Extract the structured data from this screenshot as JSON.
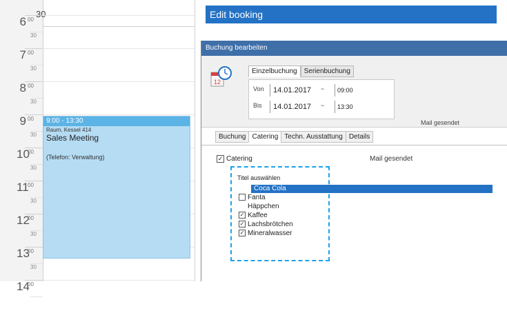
{
  "calendar": {
    "top_number": "30",
    "hours": [
      {
        "h": "6",
        "m": "00",
        "half": "30"
      },
      {
        "h": "7",
        "m": "00",
        "half": "30"
      },
      {
        "h": "8",
        "m": "00",
        "half": "30"
      },
      {
        "h": "9",
        "m": "00",
        "half": "30"
      },
      {
        "h": "10",
        "m": "00",
        "half": "30"
      },
      {
        "h": "11",
        "m": "00",
        "half": "30"
      },
      {
        "h": "12",
        "m": "00",
        "half": "30"
      },
      {
        "h": "13",
        "m": "00",
        "half": "30"
      },
      {
        "h": "14",
        "m": "00",
        "half": ""
      }
    ],
    "event": {
      "time": "9:00 - 13:30",
      "room": "Raum, Kessel 414",
      "title": "Sales Meeting",
      "phone": "(Telefon: Verwaltung)",
      "color": "#b5dcf3"
    }
  },
  "window_title": "Edit booking",
  "dialog": {
    "header": "Buchung bearbeiten",
    "tabs_top": [
      "Einzelbuchung",
      "Serienbuchung"
    ],
    "from_label": "Von",
    "to_label": "Bis",
    "from_date": "14.01.2017",
    "to_date": "14.01.2017",
    "from_time": "09:00",
    "to_time": "13:30",
    "sep": "~",
    "mail_status_top": "Mail gesendet",
    "tabs_main": [
      "Buchung",
      "Catering",
      "Techn. Ausstattung",
      "Details"
    ],
    "active_tab": "Catering",
    "catering_label": "Catering",
    "catering_checked": "✓",
    "mail_status": "Mail gesendet",
    "list_header": "Titel auswählen",
    "items": [
      {
        "label": "Coca Cola",
        "check": "",
        "selected": true
      },
      {
        "label": "Fanta",
        "check": "",
        "selected": false
      },
      {
        "label": "Häppchen",
        "check": "",
        "selected": false
      },
      {
        "label": "Kaffee",
        "check": "✓",
        "selected": false
      },
      {
        "label": "Lachsbrötchen",
        "check": "✓",
        "selected": false
      },
      {
        "label": "Mineralwasser",
        "check": "✓",
        "selected": false
      }
    ],
    "accent_color": "#2372c5",
    "highlight_frame_color": "#1aa0e6"
  }
}
